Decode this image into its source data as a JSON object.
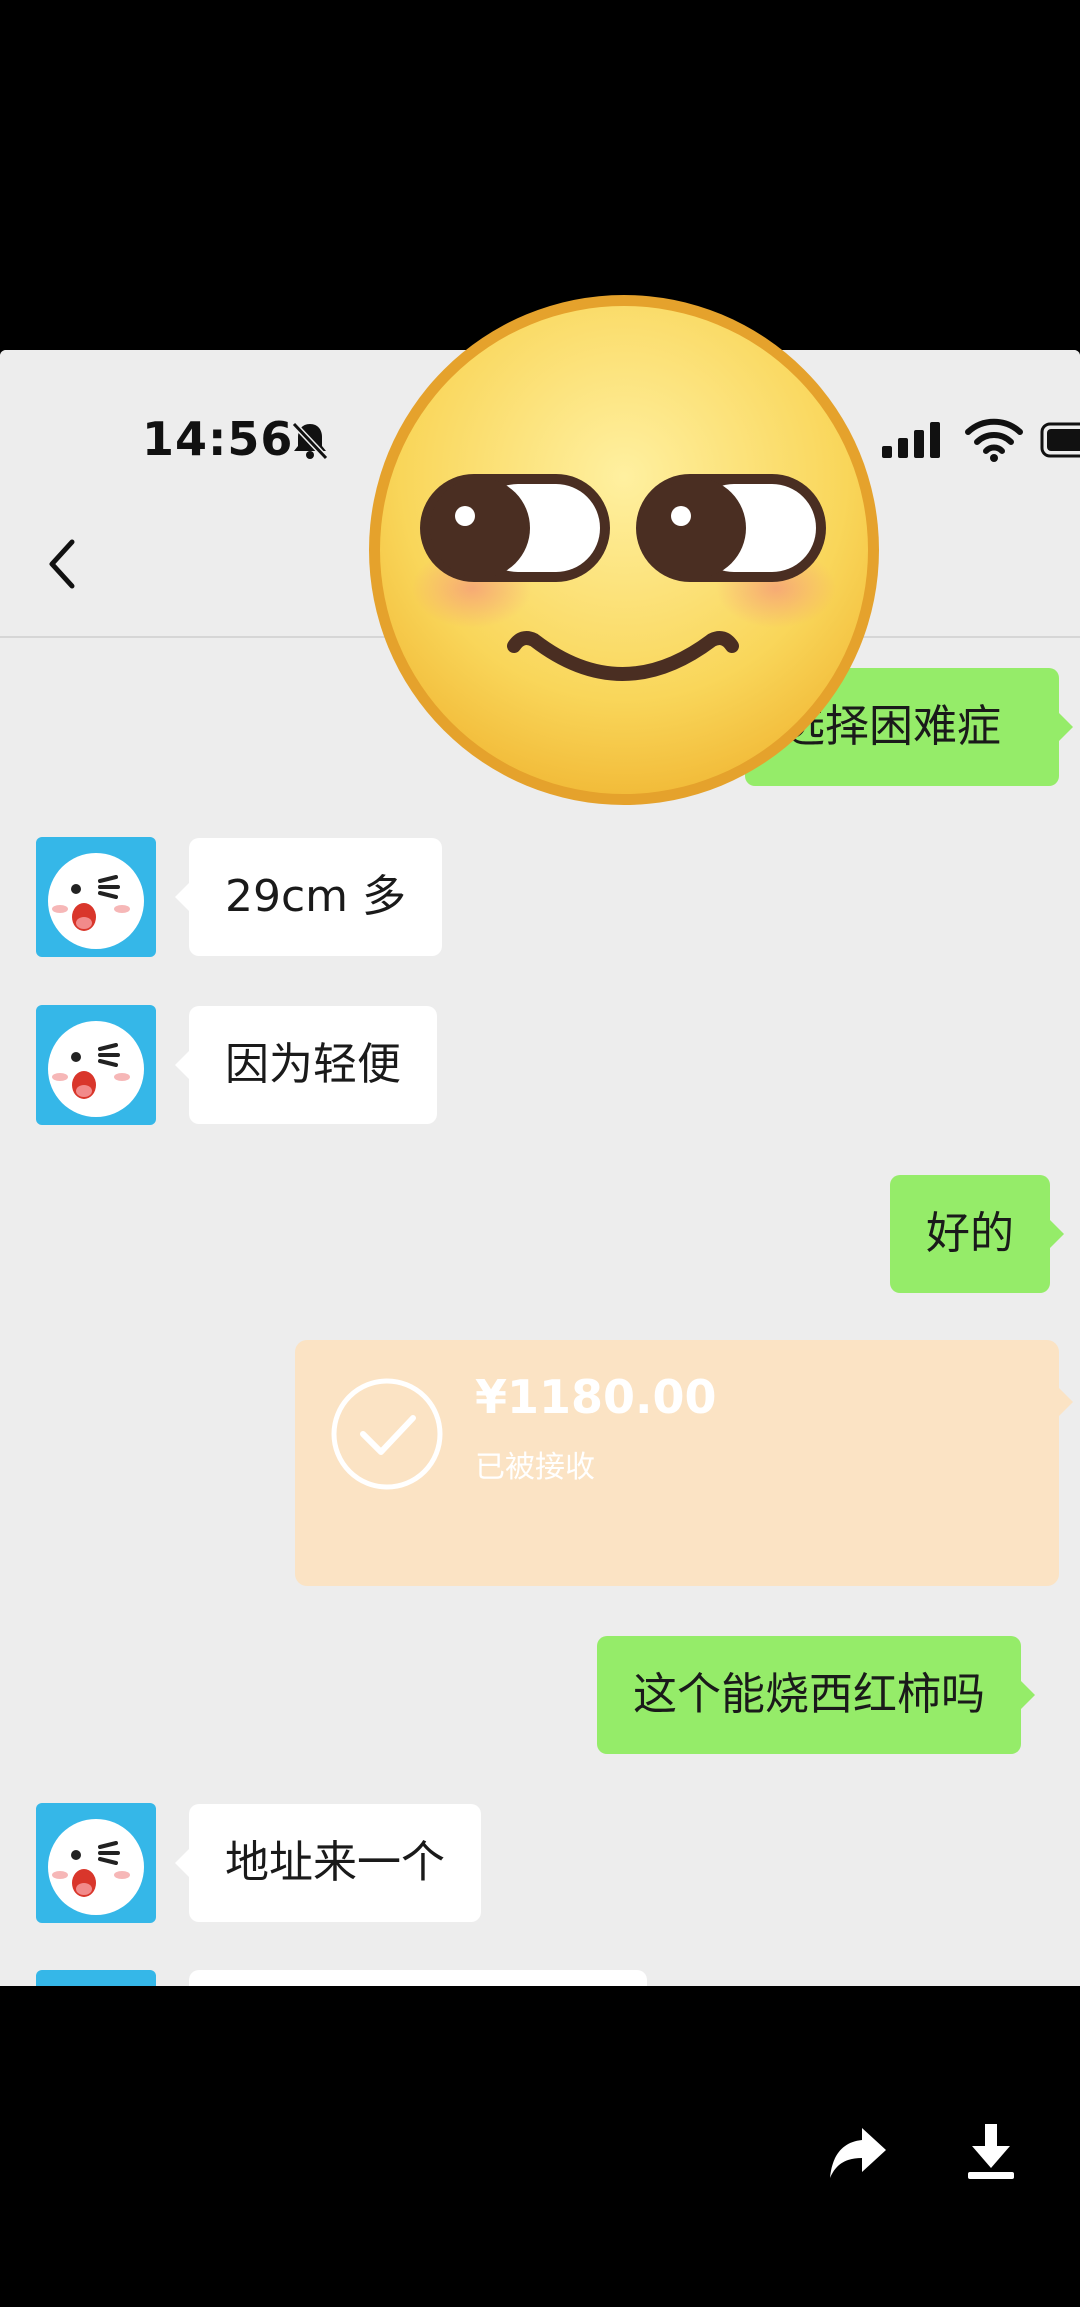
{
  "status_bar": {
    "time": "14:56",
    "icons": [
      "bell-slash-icon",
      "cellular-signal-icon",
      "wifi-icon",
      "battery-icon"
    ]
  },
  "nav": {
    "back_icon": "chevron-left-icon"
  },
  "messages": [
    {
      "side": "out",
      "text": "选择困难症",
      "visible_text": "选择困难症"
    },
    {
      "side": "in",
      "text": "29cm 多"
    },
    {
      "side": "in",
      "text": "因为轻便"
    },
    {
      "side": "out",
      "text": "好的"
    },
    {
      "side": "out",
      "type": "transfer",
      "amount": "¥1180.00",
      "status": "已被接收"
    },
    {
      "side": "out",
      "text": "这个能烧西红柿吗"
    },
    {
      "side": "in",
      "text": "地址来一个"
    }
  ],
  "overlay": {
    "sticker": "smirking-face-emoji"
  },
  "viewer_toolbar": {
    "actions": [
      "share-icon",
      "download-icon"
    ]
  },
  "colors": {
    "chat_background": "#ededed",
    "incoming_bubble": "#ffffff",
    "outgoing_bubble": "#95ec69",
    "transfer_card": "#fbe3c4",
    "avatar_background": "#35b7e8",
    "frame_background": "#000000"
  }
}
